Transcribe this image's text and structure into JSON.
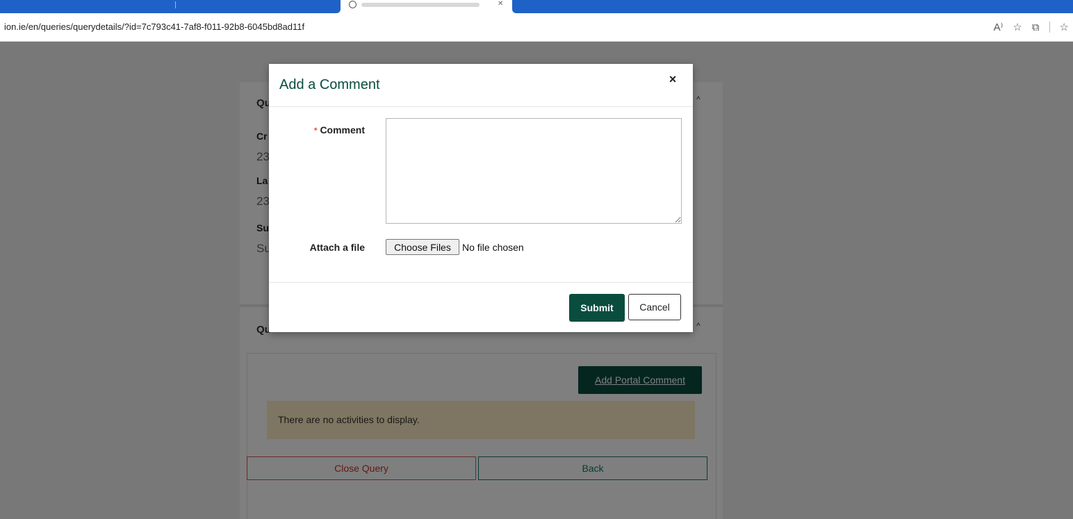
{
  "browser": {
    "url": "ion.ie/en/queries/querydetails/?id=7c793c41-7af8-f011-92b8-6045bd8ad11f",
    "icons": [
      "read-aloud-icon",
      "favorite-star-icon",
      "extensions-icon",
      "favorites-icon"
    ],
    "read_aloud_glyph": "A⁾",
    "star_glyph": "☆",
    "ext_glyph": "⧉",
    "fav_glyph": "☆"
  },
  "page": {
    "card_top": {
      "heading": "Qu",
      "fields": [
        {
          "label": "Cr",
          "value": "23"
        },
        {
          "label": "La",
          "value": "23"
        },
        {
          "label": "Su",
          "value": "Su"
        }
      ]
    },
    "card_bottom": {
      "heading": "Qu",
      "add_portal_comment": "Add Portal Comment",
      "notice": "There are no activities to display."
    },
    "actions": {
      "close_query": "Close Query",
      "back": "Back"
    }
  },
  "modal": {
    "title": "Add a Comment",
    "close_glyph": "×",
    "required_marker": "*",
    "comment_label": "Comment",
    "attach_label": "Attach a file",
    "choose_files": "Choose Files",
    "no_file": "No file chosen",
    "submit": "Submit",
    "cancel": "Cancel"
  },
  "colors": {
    "brand_green": "#0a4d3f",
    "tab_blue": "#1f62c7",
    "notice_bg": "#fcedc4",
    "danger": "#d9534f",
    "teal": "#11796b"
  }
}
